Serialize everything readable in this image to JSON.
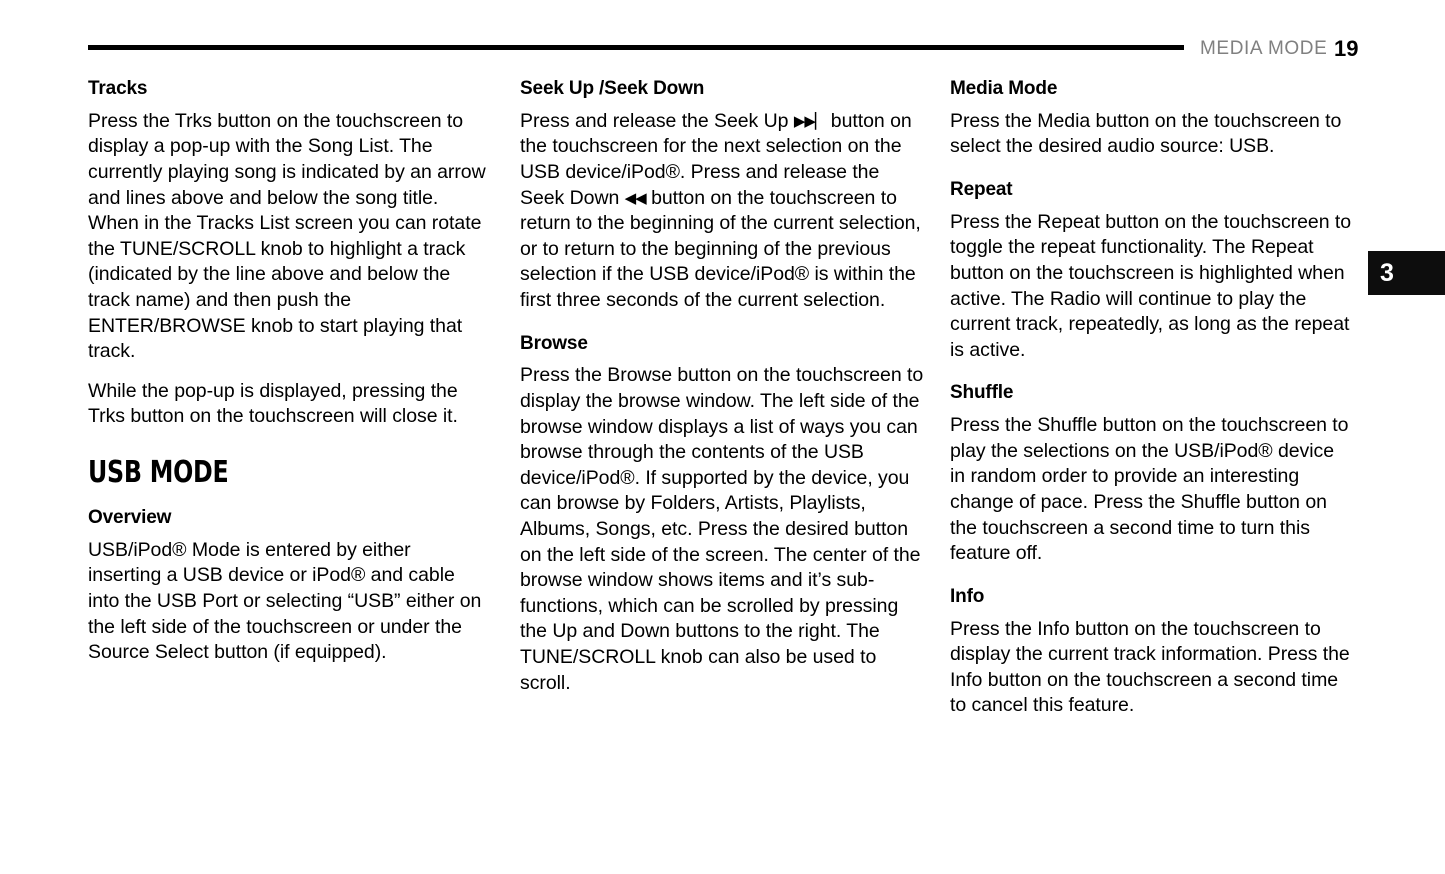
{
  "header": {
    "section_label": "MEDIA MODE",
    "page_number": "19",
    "rule": "horizontal-rule"
  },
  "chapter_tab": {
    "number": "3"
  },
  "columns": [
    {
      "id": "column-1",
      "blocks": [
        {
          "type": "sub-head",
          "text": "Tracks"
        },
        {
          "type": "body",
          "text": "Press the Trks button on the touchscreen to display a pop-up with the Song List. The currently playing song is indicated by an arrow and lines above and below the song title. When in the Tracks List screen you can rotate the TUNE/SCROLL knob to highlight a track (indicated by the line above and below the track name) and then push the ENTER/BROWSE knob to start playing that track."
        },
        {
          "type": "body",
          "text": "While the pop-up is displayed, pressing the Trks button on the touchscreen will close it."
        },
        {
          "type": "chapter-title",
          "text": "USB MODE"
        },
        {
          "type": "sub-head",
          "text": "Overview"
        },
        {
          "type": "body",
          "text": "USB/iPod® Mode is entered by either inserting a USB device or iPod® and cable into the USB Port or selecting “USB” either on the left side of the touchscreen or under the Source Select button (if equipped)."
        }
      ]
    },
    {
      "id": "column-2",
      "blocks": [
        {
          "type": "sub-head",
          "text": "Seek Up /Seek Down"
        },
        {
          "type": "body-with-glyphs",
          "segments": [
            {
              "kind": "text",
              "text": "Press and release the Seek Up "
            },
            {
              "kind": "glyph",
              "name": "seek-up-icon",
              "text": "▶▶▏"
            },
            {
              "kind": "text",
              "text": " button on the touchscreen for the next selection on the USB device/iPod®. Press and release the Seek Down "
            },
            {
              "kind": "glyph",
              "name": "seek-down-icon",
              "text": "◀◀"
            },
            {
              "kind": "text",
              "text": " button on the touchscreen to return to the beginning of the current selection, or to return to the beginning of the previous selection if the USB device/iPod® is within the first three seconds of the current selection."
            }
          ]
        },
        {
          "type": "sub-head",
          "text": "Browse"
        },
        {
          "type": "body",
          "text": "Press the Browse button on the touchscreen to display the browse window. The left side of the browse window displays a list of ways you can browse through the contents of the USB device/iPod®. If supported by the device, you can browse by Folders, Artists, Playlists, Albums, Songs, etc. Press the desired button on the left side of the screen. The center of the browse window shows items and it’s sub-functions, which can be scrolled by pressing the Up and Down buttons to the right. The TUNE/SCROLL knob can also be used to scroll."
        }
      ]
    },
    {
      "id": "column-3",
      "blocks": [
        {
          "type": "sub-head",
          "text": "Media Mode"
        },
        {
          "type": "body",
          "text": "Press the Media button on the touchscreen to select the desired audio source: USB."
        },
        {
          "type": "sub-head",
          "text": "Repeat"
        },
        {
          "type": "body",
          "text": "Press the Repeat button on the touchscreen to toggle the repeat functionality. The Repeat button on the touchscreen is highlighted when active. The Radio will continue to play the current track, repeatedly, as long as the repeat is active."
        },
        {
          "type": "sub-head",
          "text": "Shuffle"
        },
        {
          "type": "body",
          "text": "Press the Shuffle button on the touchscreen to play the selections on the USB/iPod® device in random order to provide an interesting change of pace. Press the Shuffle button on the touchscreen a second time to turn this feature off."
        },
        {
          "type": "sub-head",
          "text": "Info"
        },
        {
          "type": "body",
          "text": "Press the Info button on the touchscreen to display the current track information. Press the Info button on the touchscreen a second time to cancel this feature."
        }
      ]
    }
  ],
  "colors": {
    "text": "#000000",
    "header_section": "#808080",
    "tab_background": "#0d0d0d",
    "tab_text": "#ffffff",
    "page_background": "#ffffff"
  }
}
